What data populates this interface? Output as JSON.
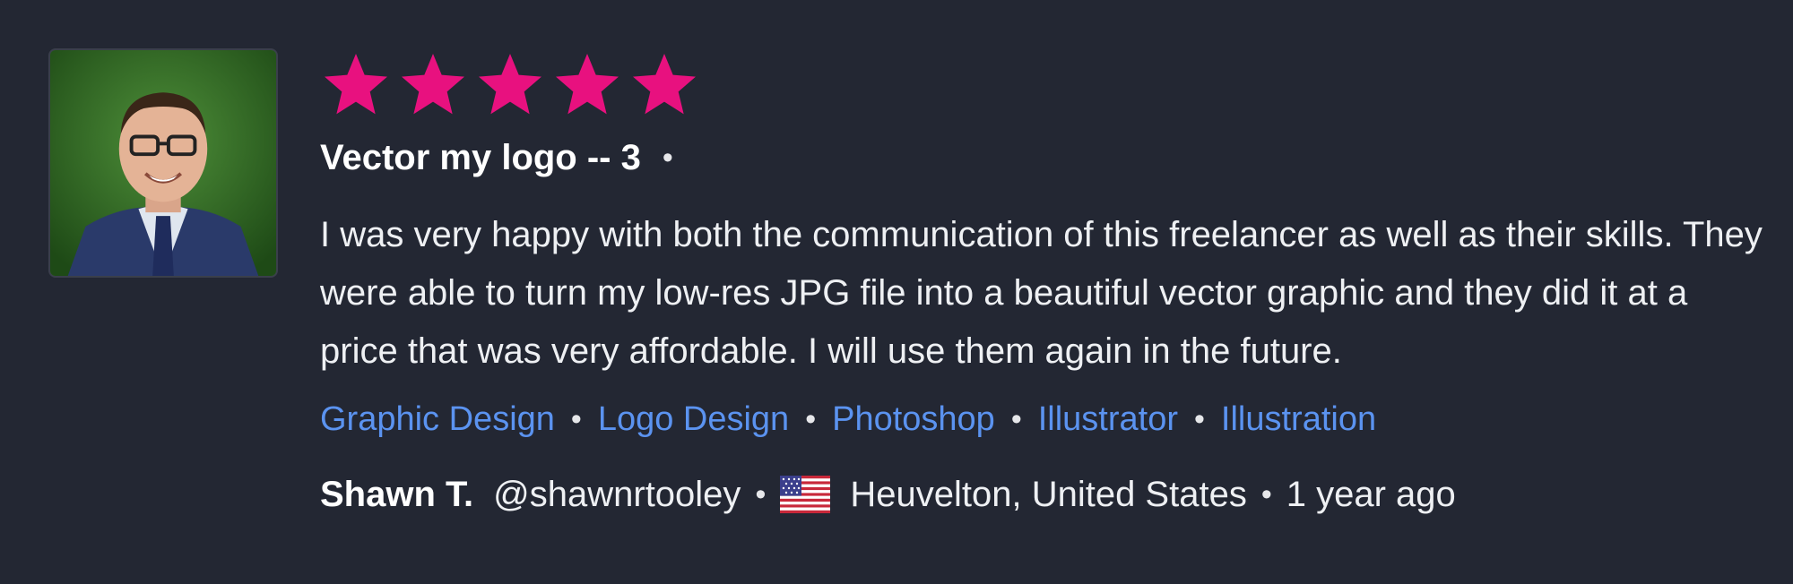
{
  "review": {
    "avatar_icon": "reviewer-photo",
    "rating": 5,
    "rating_max": 5,
    "star_color": "#e8117f",
    "project_title": "Vector my logo -- 3",
    "separator": "•",
    "body": "I was very happy with both the communication of this freelancer as well as their skills. They were able to turn my low-res JPG file into a beautiful vector graphic and they did it at a price that was very affordable. I will use them again in the future.",
    "tags": [
      {
        "label": "Graphic Design"
      },
      {
        "label": "Logo Design"
      },
      {
        "label": "Photoshop"
      },
      {
        "label": "Illustrator"
      },
      {
        "label": "Illustration"
      }
    ],
    "tag_color": "#5b93f0",
    "reviewer": {
      "name": "Shawn T.",
      "handle": "@shawnrtooley",
      "flag_icon": "us-flag-icon",
      "location": "Heuvelton, United States",
      "time_ago": "1 year ago"
    }
  }
}
